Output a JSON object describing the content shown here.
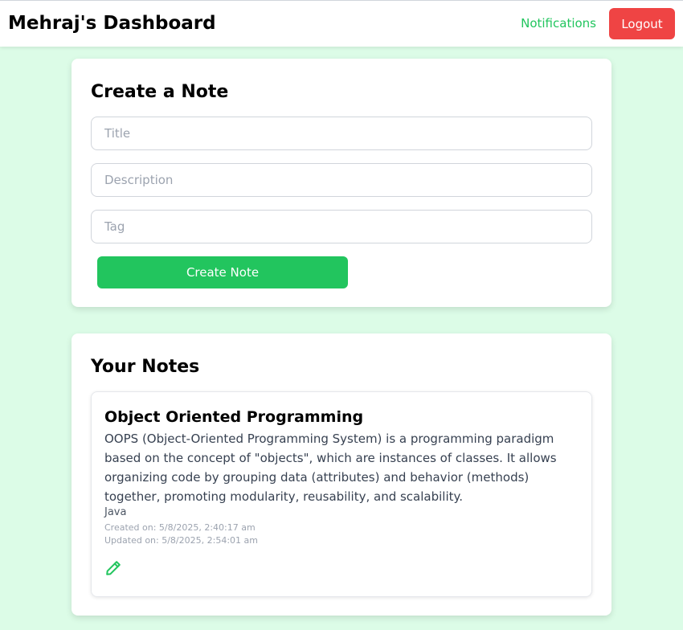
{
  "header": {
    "title": "Mehraj's Dashboard",
    "notifications_label": "Notifications",
    "logout_label": "Logout"
  },
  "create_note": {
    "heading": "Create a Note",
    "title_placeholder": "Title",
    "title_value": "",
    "description_placeholder": "Description",
    "description_value": "",
    "tag_placeholder": "Tag",
    "tag_value": "",
    "submit_label": "Create Note"
  },
  "notes_section": {
    "heading": "Your Notes",
    "notes": [
      {
        "title": "Object Oriented Programming",
        "description": "OOPS (Object-Oriented Programming System) is a programming paradigm based on the concept of \"objects\", which are instances of classes. It allows organizing code by grouping data (attributes) and behavior (methods) together, promoting modularity, reusability, and scalability.",
        "tag": "Java",
        "created": "Created on: 5/8/2025, 2:40:17 am",
        "updated": "Updated on: 5/8/2025, 2:54:01 am",
        "edit_icon": "pencil-icon"
      }
    ]
  },
  "colors": {
    "background": "#dcfce7",
    "accent_green": "#22c55e",
    "logout_red": "#ef4444"
  }
}
